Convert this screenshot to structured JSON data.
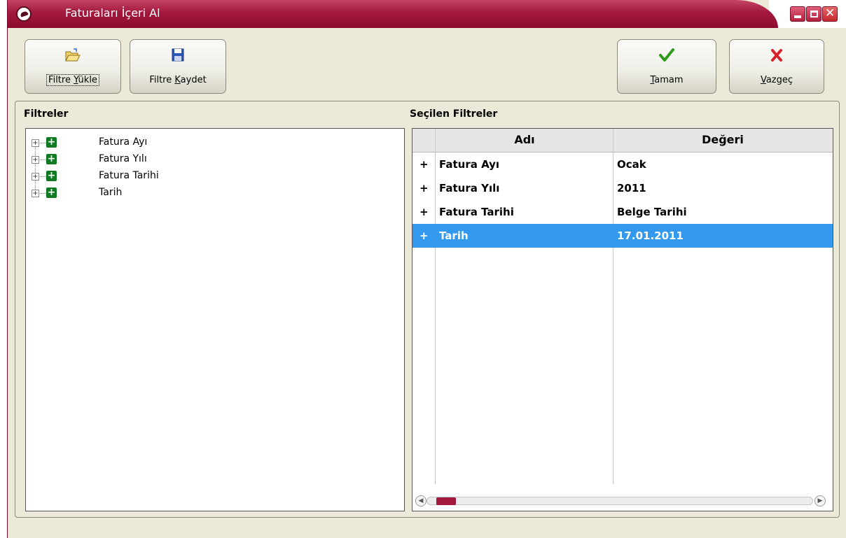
{
  "window": {
    "title": "Faturaları İçeri Al",
    "accent_color": "#a3183d"
  },
  "toolbar": {
    "load_filter": {
      "label_pre": "Filtre ",
      "label_mnemonic": "Y",
      "label_post": "ükle",
      "icon": "open-folder-icon"
    },
    "save_filter": {
      "label_pre": "Filtre ",
      "label_mnemonic": "K",
      "label_post": "aydet",
      "icon": "floppy-disk-icon"
    },
    "ok": {
      "label_pre": "",
      "label_mnemonic": "T",
      "label_post": "amam",
      "icon": "green-check-icon"
    },
    "cancel": {
      "label_pre": "",
      "label_mnemonic": "V",
      "label_post": "azgeç",
      "icon": "red-x-icon"
    }
  },
  "filters_panel": {
    "title": "Filtreler",
    "items": [
      {
        "label": "Fatura Ayı"
      },
      {
        "label": "Fatura Yılı"
      },
      {
        "label": "Fatura Tarihi"
      },
      {
        "label": "Tarih"
      }
    ]
  },
  "selected_panel": {
    "title": "Seçilen Filtreler",
    "columns": {
      "name": "Adı",
      "value": "Değeri"
    },
    "rows": [
      {
        "marker": "+",
        "name": "Fatura Ayı",
        "value": "Ocak",
        "selected": false
      },
      {
        "marker": "+",
        "name": "Fatura Yılı",
        "value": "2011",
        "selected": false
      },
      {
        "marker": "+",
        "name": "Fatura Tarihi",
        "value": "Belge Tarihi",
        "selected": false
      },
      {
        "marker": "+",
        "name": "Tarih",
        "value": "17.01.2011",
        "selected": true
      }
    ],
    "selection_color": "#3399ee"
  }
}
